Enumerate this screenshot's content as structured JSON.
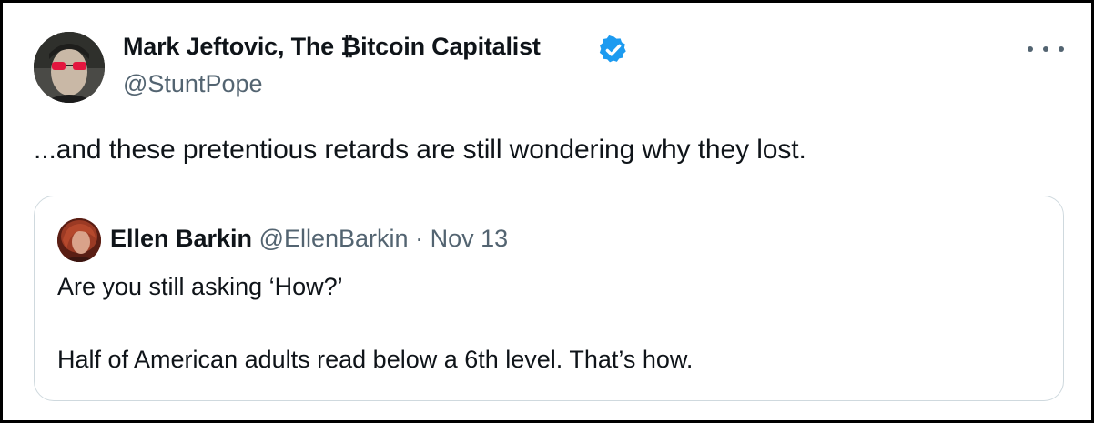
{
  "tweet": {
    "author": {
      "display_name": "Mark Jeftovic, The ₿itcoin Capitalist",
      "handle": "@StuntPope",
      "verified": true,
      "avatar_icon": "profile-photo-man-red-glasses"
    },
    "more_icon": "ellipsis-icon",
    "text": "...and these pretentious retards are still wondering why they lost.",
    "colors": {
      "verified_blue": "#1d9bf0",
      "secondary_text": "#536471",
      "border": "#cfd9de"
    }
  },
  "quoted_tweet": {
    "author": {
      "display_name": "Ellen Barkin",
      "handle": "@EllenBarkin",
      "avatar_icon": "profile-photo-woman"
    },
    "separator": "·",
    "date": "Nov 13",
    "line1": "Are you still asking ‘How?’",
    "line2": "Half of American adults read below a 6th level. That’s how."
  }
}
